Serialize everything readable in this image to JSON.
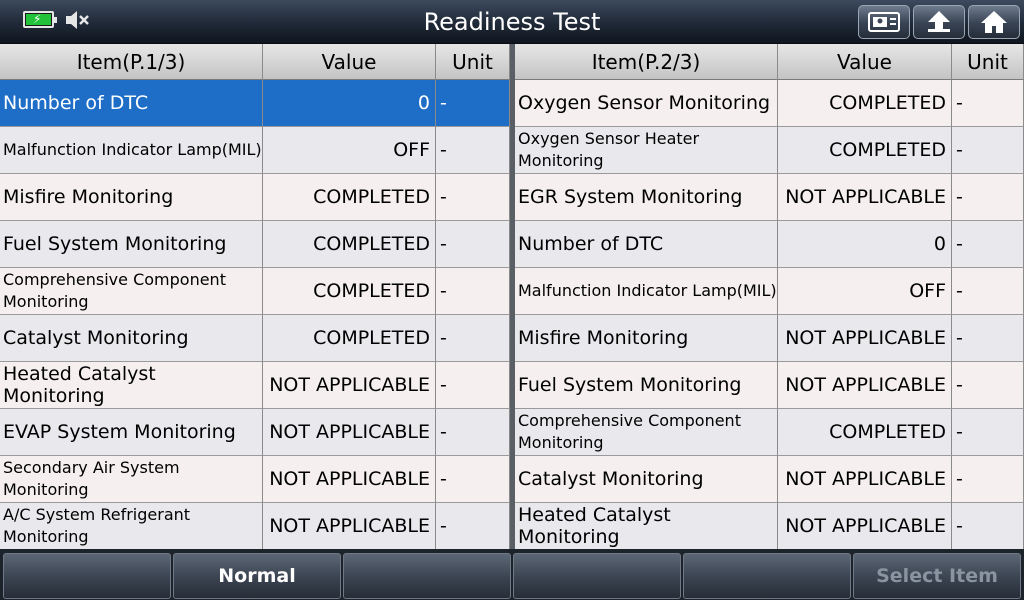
{
  "header": {
    "title": "Readiness Test",
    "icons": [
      "battery-icon",
      "mute-icon",
      "report-icon",
      "back-icon",
      "home-icon"
    ]
  },
  "left_table": {
    "headers": [
      "Item(P.1/3)",
      "Value",
      "Unit"
    ],
    "rows": [
      {
        "item": "Number of DTC",
        "value": "0",
        "unit": "-"
      },
      {
        "item": "Malfunction Indicator Lamp(MIL)",
        "value": "OFF",
        "unit": "-"
      },
      {
        "item": "Misfire Monitoring",
        "value": "COMPLETED",
        "unit": "-"
      },
      {
        "item": "Fuel System Monitoring",
        "value": "COMPLETED",
        "unit": "-"
      },
      {
        "item": "Comprehensive Component Monitoring",
        "value": "COMPLETED",
        "unit": "-"
      },
      {
        "item": "Catalyst Monitoring",
        "value": "COMPLETED",
        "unit": "-"
      },
      {
        "item": "Heated Catalyst Monitoring",
        "value": "NOT APPLICABLE",
        "unit": "-"
      },
      {
        "item": "EVAP System Monitoring",
        "value": "NOT APPLICABLE",
        "unit": "-"
      },
      {
        "item": "Secondary Air System Monitoring",
        "value": "NOT APPLICABLE",
        "unit": "-"
      },
      {
        "item": "A/C System Refrigerant Monitoring",
        "value": "NOT APPLICABLE",
        "unit": "-"
      }
    ]
  },
  "right_table": {
    "headers": [
      "Item(P.2/3)",
      "Value",
      "Unit"
    ],
    "rows": [
      {
        "item": "Oxygen Sensor Monitoring",
        "value": "COMPLETED",
        "unit": "-"
      },
      {
        "item": "Oxygen Sensor Heater Monitoring",
        "value": "COMPLETED",
        "unit": "-"
      },
      {
        "item": "EGR System Monitoring",
        "value": "NOT APPLICABLE",
        "unit": "-"
      },
      {
        "item": "Number of DTC",
        "value": "0",
        "unit": "-"
      },
      {
        "item": "Malfunction Indicator Lamp(MIL)",
        "value": "OFF",
        "unit": "-"
      },
      {
        "item": "Misfire Monitoring",
        "value": "NOT APPLICABLE",
        "unit": "-"
      },
      {
        "item": "Fuel System Monitoring",
        "value": "NOT APPLICABLE",
        "unit": "-"
      },
      {
        "item": "Comprehensive Component Monitoring",
        "value": "COMPLETED",
        "unit": "-"
      },
      {
        "item": "Catalyst Monitoring",
        "value": "NOT APPLICABLE",
        "unit": "-"
      },
      {
        "item": "Heated Catalyst Monitoring",
        "value": "NOT APPLICABLE",
        "unit": "-"
      }
    ]
  },
  "footer": {
    "buttons": [
      "",
      "Normal",
      "",
      "",
      "",
      "Select Item"
    ]
  },
  "colors": {
    "selected_row": "#1e6ec8",
    "header_bar": "#1f2937"
  }
}
